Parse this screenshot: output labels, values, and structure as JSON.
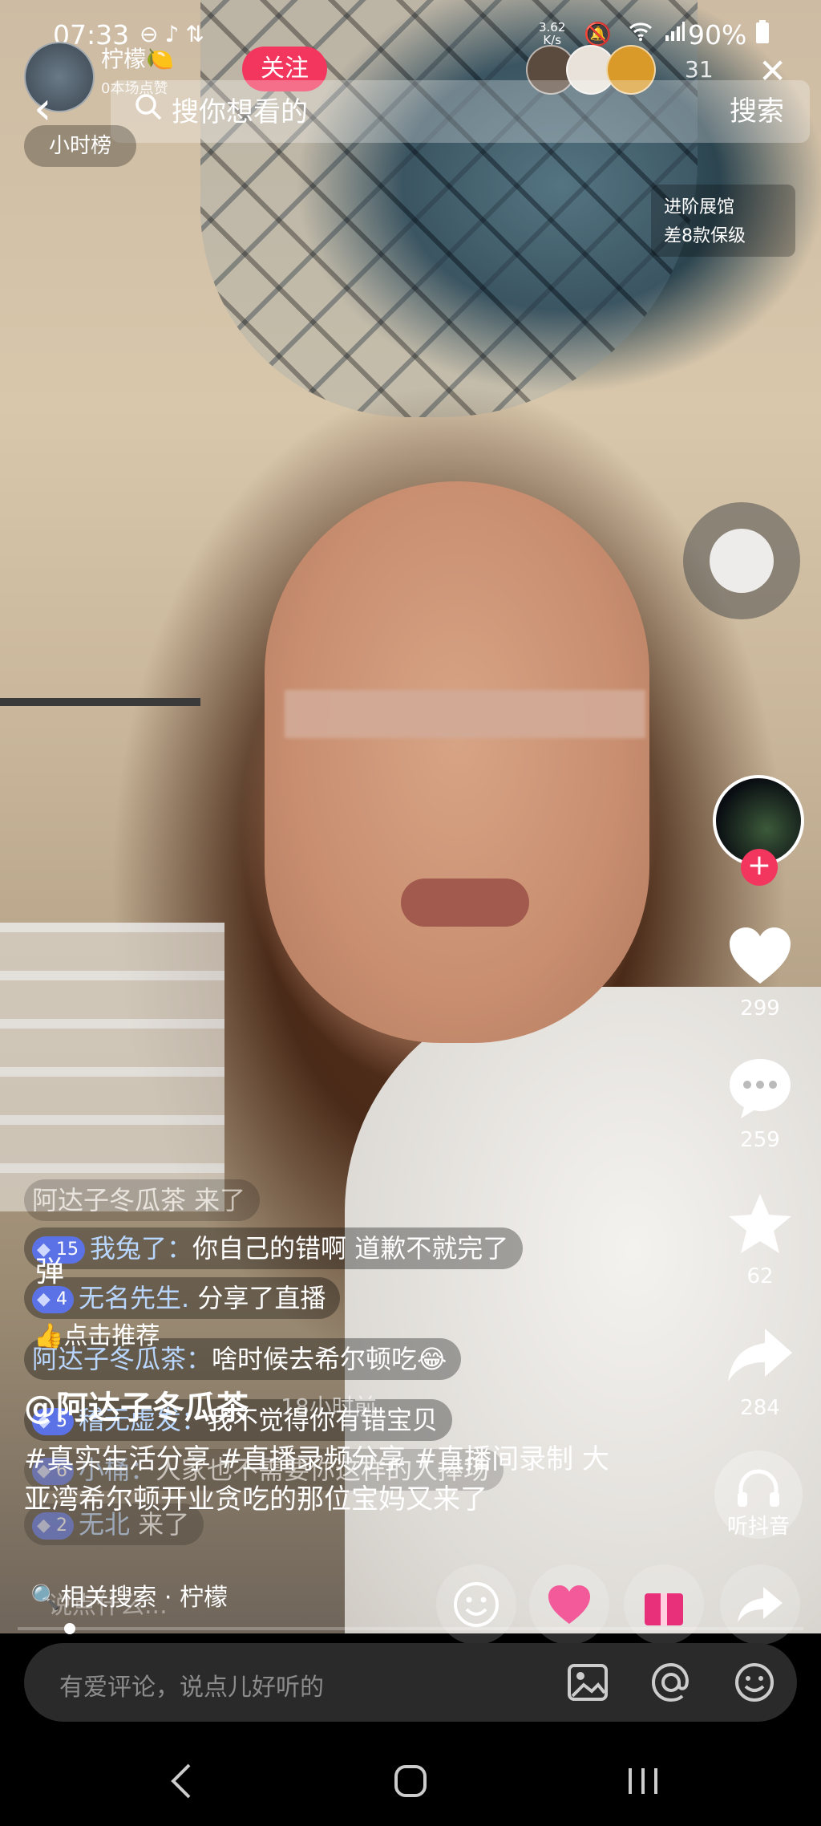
{
  "status_bar": {
    "time": "07:33",
    "net_speed_value": "3.62",
    "net_speed_unit": "K/s",
    "battery": "90%",
    "left_icons": [
      "minus-circle-icon",
      "tiktok-icon",
      "transfer-icon"
    ],
    "right_icons": [
      "mute-icon",
      "wifi-icon",
      "signal-icon",
      "battery-icon"
    ]
  },
  "header": {
    "streamer_name": "柠檬",
    "streamer_name_emoji": "🍋",
    "likes_text": "0本场点赞",
    "follow_label": "关注",
    "viewer_count": "31",
    "hour_rank_label": "小时榜"
  },
  "search": {
    "placeholder": "搜你想看的",
    "button_label": "搜索"
  },
  "gallery_badge": {
    "line1": "进阶展馆",
    "line2": "差8款保级"
  },
  "actions": {
    "likes": "299",
    "comments": "259",
    "favorites": "62",
    "shares": "284",
    "listen_label": "听抖音"
  },
  "chat": [
    {
      "text": "阿达子冬瓜茶 来了",
      "faded": true
    },
    {
      "level": "15",
      "user": "我兔了：",
      "text": "你自己的错啊 道歉不就完了"
    },
    {
      "level": "4",
      "user": "无名先生.",
      "text": "分享了直播"
    },
    {
      "user": "阿达子冬瓜茶：",
      "text": "啥时候去希尔顿吃",
      "emoji": "😂"
    },
    {
      "level": "5",
      "user": "稽无虚发：",
      "text": "我不觉得你有错宝贝"
    },
    {
      "level": "6",
      "user": "小桶：",
      "text": "人家也不需要你这样的人捧场"
    },
    {
      "level": "2",
      "user": "无北",
      "text": "来了"
    }
  ],
  "danmu_label": "弹",
  "recommend_label": "点击推荐",
  "post": {
    "author": "@阿达子冬瓜茶",
    "time_ago": "18小时前",
    "description": "#真实生活分享 #直播录频分享 #直播间录制 大亚湾希尔顿开业贪吃的那位宝妈又来了"
  },
  "related_search": "相关搜索 · 柠檬",
  "comment_hint": "说点什么...",
  "comment_bar": {
    "placeholder": "有爱评论，说点儿好听的"
  },
  "colors": {
    "accent": "#f2365e",
    "badge": "#5b72e6",
    "username": "#b9d6ff"
  }
}
